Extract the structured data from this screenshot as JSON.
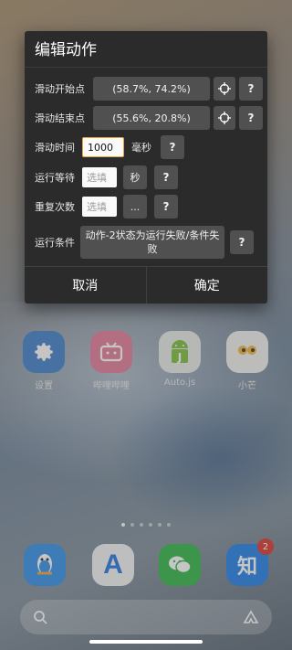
{
  "dialog": {
    "title": "编辑动作",
    "rows": {
      "swipe_start": {
        "label": "滑动开始点",
        "value": "(58.7%, 74.2%)"
      },
      "swipe_end": {
        "label": "滑动结束点",
        "value": "(55.6%, 20.8%)"
      },
      "swipe_time": {
        "label": "滑动时间",
        "value": "1000",
        "unit": "毫秒"
      },
      "run_wait": {
        "label": "运行等待",
        "placeholder": "选填",
        "unit_button": "秒"
      },
      "repeat": {
        "label": "重复次数",
        "placeholder": "选填",
        "more_button": "..."
      },
      "condition": {
        "label": "运行条件",
        "value": "动作-2状态为运行失败/条件失败"
      }
    },
    "help_label": "?",
    "cancel": "取消",
    "confirm": "确定"
  },
  "launcher": {
    "apps": [
      {
        "label": "设置"
      },
      {
        "label": "哔哩哔哩"
      },
      {
        "label": "Auto.js"
      },
      {
        "label": "小芒"
      }
    ],
    "dock": {
      "zhihu_badge": "2",
      "zhihu_glyph": "知",
      "store_glyph": "A"
    }
  },
  "colors": {
    "dialog_bg": "#2b2b2b",
    "button_bg": "#505050",
    "badge": "#d9342b"
  }
}
